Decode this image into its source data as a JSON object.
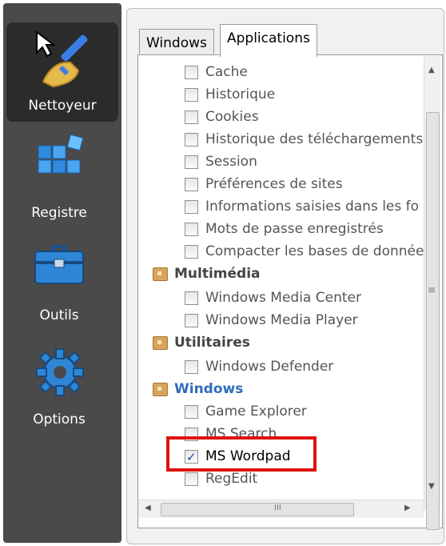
{
  "sidebar": {
    "items": [
      {
        "label": "Nettoyeur",
        "icon": "broom-icon",
        "active": true
      },
      {
        "label": "Registre",
        "icon": "registry-cubes-icon",
        "active": false
      },
      {
        "label": "Outils",
        "icon": "toolbox-icon",
        "active": false
      },
      {
        "label": "Options",
        "icon": "gear-icon",
        "active": false
      }
    ]
  },
  "tabs": [
    {
      "label": "Windows",
      "selected": false
    },
    {
      "label": "Applications",
      "selected": true
    }
  ],
  "list": {
    "firefox_items": [
      {
        "label": "Cache",
        "checked": false
      },
      {
        "label": "Historique",
        "checked": false
      },
      {
        "label": "Cookies",
        "checked": false
      },
      {
        "label": "Historique des téléchargements",
        "checked": false
      },
      {
        "label": "Session",
        "checked": false
      },
      {
        "label": "Préférences de sites",
        "checked": false
      },
      {
        "label": "Informations saisies dans les fo",
        "checked": false
      },
      {
        "label": "Mots de passe enregistrés",
        "checked": false
      },
      {
        "label": "Compacter les bases de donnée",
        "checked": false
      }
    ],
    "multimedia": {
      "label": "Multimédia",
      "items": [
        {
          "label": "Windows Media Center",
          "checked": false
        },
        {
          "label": "Windows Media Player",
          "checked": false
        }
      ]
    },
    "utilitaires": {
      "label": "Utilitaires",
      "items": [
        {
          "label": "Windows Defender",
          "checked": false
        }
      ]
    },
    "windows": {
      "label": "Windows",
      "items": [
        {
          "label": "Game Explorer",
          "checked": false
        },
        {
          "label": "MS Search",
          "checked": false
        },
        {
          "label": "MS Wordpad",
          "checked": true
        },
        {
          "label": "RegEdit",
          "checked": false
        }
      ]
    }
  },
  "colors": {
    "sidebar_bg": "#4a4a4a",
    "active_bg": "#2b2b2b",
    "category_blue": "#2f6db8",
    "highlight_red": "#e01010"
  }
}
